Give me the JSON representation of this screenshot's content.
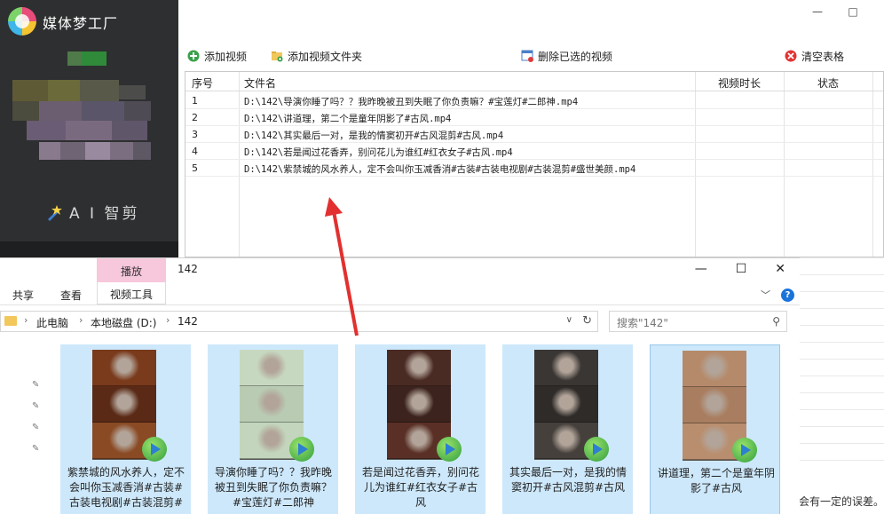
{
  "app": {
    "title": "媒体梦工厂",
    "ai_badge": "A I 智剪",
    "window_controls": [
      "—",
      "□"
    ]
  },
  "toolbar": {
    "add_video": "添加视频",
    "add_folder": "添加视频文件夹",
    "delete_selected": "删除已选的视频",
    "clear_table": "清空表格"
  },
  "table": {
    "headers": [
      "序号",
      "文件名",
      "视频时长",
      "状态"
    ],
    "rows": [
      {
        "index": "1",
        "filename": "D:\\142\\导演你睡了吗？？我昨晚被丑到失眠了你负责嘛？#宝莲灯#二郎神.mp4"
      },
      {
        "index": "2",
        "filename": "D:\\142\\讲道理，第二个是童年阴影了#古风.mp4"
      },
      {
        "index": "3",
        "filename": "D:\\142\\其实最后一对，是我的情窦初开#古风混剪#古风.mp4"
      },
      {
        "index": "4",
        "filename": "D:\\142\\若是闻过花香弄，别问花儿为谁红#红衣女子#古风.mp4"
      },
      {
        "index": "5",
        "filename": "D:\\142\\紫禁城的风水养人，定不会叫你玉减香消#古装#古装电视剧#古装混剪#盛世美颜.mp4"
      }
    ]
  },
  "note_right": "会有一定的误差。",
  "explorer": {
    "context_tab_top": "播放",
    "context_tab_bottom": "视频工具",
    "tabs": [
      "共享",
      "查看"
    ],
    "folder_title": "142",
    "controls": [
      "—",
      "☐",
      "✕"
    ],
    "address": {
      "parts": [
        "此电脑",
        "本地磁盘 (D:)",
        "142"
      ]
    },
    "search_placeholder": "搜索\"142\"",
    "tiles": [
      {
        "caption": "紫禁城的风水养人，定不会叫你玉减香消#古装#古装电视剧#古装混剪#",
        "colors": [
          "#7a3a1c",
          "#5a2a16",
          "#8a4a24"
        ],
        "selected": false
      },
      {
        "caption": "导演你睡了吗？？我昨晚被丑到失眠了你负责嘛？#宝莲灯#二郎神",
        "colors": [
          "#c7d8c0",
          "#b9ccb3",
          "#c3d6bd"
        ],
        "selected": false
      },
      {
        "caption": "若是闻过花香弄，别问花儿为谁红#红衣女子#古风",
        "colors": [
          "#4a2b24",
          "#3c231d",
          "#5a3026"
        ],
        "selected": false
      },
      {
        "caption": "其实最后一对，是我的情窦初开#古风混剪#古风",
        "colors": [
          "#3a3634",
          "#2e2b29",
          "#45403c"
        ],
        "selected": false
      },
      {
        "caption": "讲道理，第二个是童年阴影了#古风",
        "colors": [
          "#b58a6a",
          "#a97e60",
          "#b98e6e"
        ],
        "selected": true
      }
    ]
  }
}
